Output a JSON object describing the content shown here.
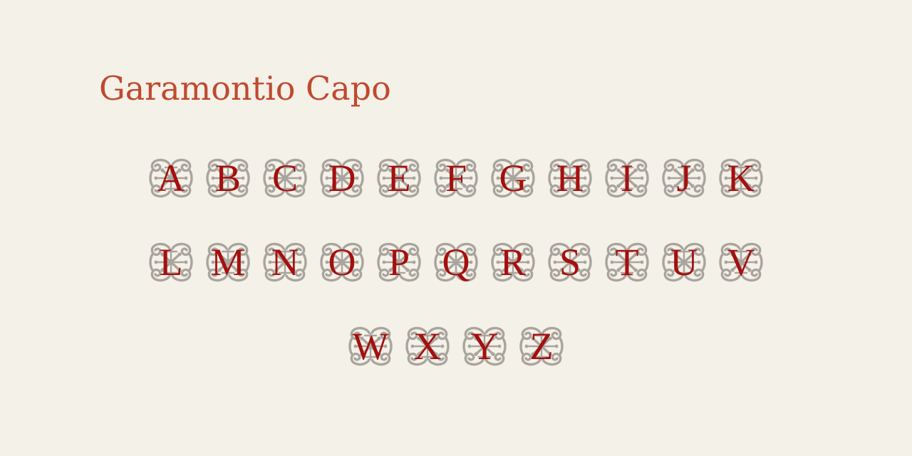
{
  "title": "Garamontio Capo",
  "ornament_color": "#a9a59e",
  "letter_color": "#a50f0f",
  "title_color": "#c0492f",
  "rows": [
    [
      "A",
      "B",
      "C",
      "D",
      "E",
      "F",
      "G",
      "H",
      "I",
      "J",
      "K"
    ],
    [
      "L",
      "M",
      "N",
      "O",
      "P",
      "Q",
      "R",
      "S",
      "T",
      "U",
      "V"
    ],
    [
      "W",
      "X",
      "Y",
      "Z"
    ]
  ]
}
